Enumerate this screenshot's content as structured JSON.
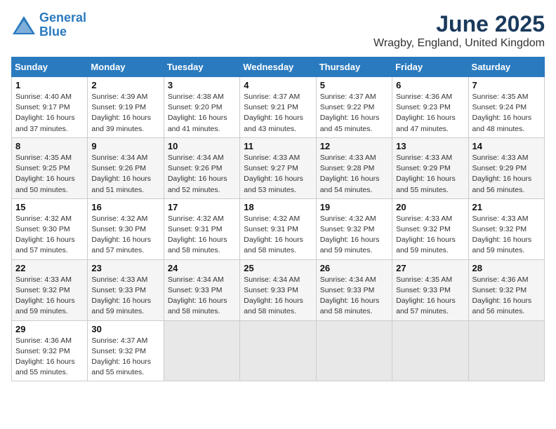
{
  "header": {
    "logo_line1": "General",
    "logo_line2": "Blue",
    "month_title": "June 2025",
    "location": "Wragby, England, United Kingdom"
  },
  "calendar": {
    "days_of_week": [
      "Sunday",
      "Monday",
      "Tuesday",
      "Wednesday",
      "Thursday",
      "Friday",
      "Saturday"
    ],
    "weeks": [
      [
        {
          "num": "",
          "info": ""
        },
        {
          "num": "2",
          "info": "Sunrise: 4:39 AM\nSunset: 9:19 PM\nDaylight: 16 hours\nand 39 minutes."
        },
        {
          "num": "3",
          "info": "Sunrise: 4:38 AM\nSunset: 9:20 PM\nDaylight: 16 hours\nand 41 minutes."
        },
        {
          "num": "4",
          "info": "Sunrise: 4:37 AM\nSunset: 9:21 PM\nDaylight: 16 hours\nand 43 minutes."
        },
        {
          "num": "5",
          "info": "Sunrise: 4:37 AM\nSunset: 9:22 PM\nDaylight: 16 hours\nand 45 minutes."
        },
        {
          "num": "6",
          "info": "Sunrise: 4:36 AM\nSunset: 9:23 PM\nDaylight: 16 hours\nand 47 minutes."
        },
        {
          "num": "7",
          "info": "Sunrise: 4:35 AM\nSunset: 9:24 PM\nDaylight: 16 hours\nand 48 minutes."
        }
      ],
      [
        {
          "num": "1",
          "info": "Sunrise: 4:40 AM\nSunset: 9:17 PM\nDaylight: 16 hours\nand 37 minutes."
        },
        {
          "num": "",
          "info": ""
        },
        {
          "num": "",
          "info": ""
        },
        {
          "num": "",
          "info": ""
        },
        {
          "num": "",
          "info": ""
        },
        {
          "num": "",
          "info": ""
        },
        {
          "num": "",
          "info": ""
        }
      ],
      [
        {
          "num": "8",
          "info": "Sunrise: 4:35 AM\nSunset: 9:25 PM\nDaylight: 16 hours\nand 50 minutes."
        },
        {
          "num": "9",
          "info": "Sunrise: 4:34 AM\nSunset: 9:26 PM\nDaylight: 16 hours\nand 51 minutes."
        },
        {
          "num": "10",
          "info": "Sunrise: 4:34 AM\nSunset: 9:26 PM\nDaylight: 16 hours\nand 52 minutes."
        },
        {
          "num": "11",
          "info": "Sunrise: 4:33 AM\nSunset: 9:27 PM\nDaylight: 16 hours\nand 53 minutes."
        },
        {
          "num": "12",
          "info": "Sunrise: 4:33 AM\nSunset: 9:28 PM\nDaylight: 16 hours\nand 54 minutes."
        },
        {
          "num": "13",
          "info": "Sunrise: 4:33 AM\nSunset: 9:29 PM\nDaylight: 16 hours\nand 55 minutes."
        },
        {
          "num": "14",
          "info": "Sunrise: 4:33 AM\nSunset: 9:29 PM\nDaylight: 16 hours\nand 56 minutes."
        }
      ],
      [
        {
          "num": "15",
          "info": "Sunrise: 4:32 AM\nSunset: 9:30 PM\nDaylight: 16 hours\nand 57 minutes."
        },
        {
          "num": "16",
          "info": "Sunrise: 4:32 AM\nSunset: 9:30 PM\nDaylight: 16 hours\nand 57 minutes."
        },
        {
          "num": "17",
          "info": "Sunrise: 4:32 AM\nSunset: 9:31 PM\nDaylight: 16 hours\nand 58 minutes."
        },
        {
          "num": "18",
          "info": "Sunrise: 4:32 AM\nSunset: 9:31 PM\nDaylight: 16 hours\nand 58 minutes."
        },
        {
          "num": "19",
          "info": "Sunrise: 4:32 AM\nSunset: 9:32 PM\nDaylight: 16 hours\nand 59 minutes."
        },
        {
          "num": "20",
          "info": "Sunrise: 4:33 AM\nSunset: 9:32 PM\nDaylight: 16 hours\nand 59 minutes."
        },
        {
          "num": "21",
          "info": "Sunrise: 4:33 AM\nSunset: 9:32 PM\nDaylight: 16 hours\nand 59 minutes."
        }
      ],
      [
        {
          "num": "22",
          "info": "Sunrise: 4:33 AM\nSunset: 9:32 PM\nDaylight: 16 hours\nand 59 minutes."
        },
        {
          "num": "23",
          "info": "Sunrise: 4:33 AM\nSunset: 9:33 PM\nDaylight: 16 hours\nand 59 minutes."
        },
        {
          "num": "24",
          "info": "Sunrise: 4:34 AM\nSunset: 9:33 PM\nDaylight: 16 hours\nand 58 minutes."
        },
        {
          "num": "25",
          "info": "Sunrise: 4:34 AM\nSunset: 9:33 PM\nDaylight: 16 hours\nand 58 minutes."
        },
        {
          "num": "26",
          "info": "Sunrise: 4:34 AM\nSunset: 9:33 PM\nDaylight: 16 hours\nand 58 minutes."
        },
        {
          "num": "27",
          "info": "Sunrise: 4:35 AM\nSunset: 9:33 PM\nDaylight: 16 hours\nand 57 minutes."
        },
        {
          "num": "28",
          "info": "Sunrise: 4:36 AM\nSunset: 9:32 PM\nDaylight: 16 hours\nand 56 minutes."
        }
      ],
      [
        {
          "num": "29",
          "info": "Sunrise: 4:36 AM\nSunset: 9:32 PM\nDaylight: 16 hours\nand 55 minutes."
        },
        {
          "num": "30",
          "info": "Sunrise: 4:37 AM\nSunset: 9:32 PM\nDaylight: 16 hours\nand 55 minutes."
        },
        {
          "num": "",
          "info": ""
        },
        {
          "num": "",
          "info": ""
        },
        {
          "num": "",
          "info": ""
        },
        {
          "num": "",
          "info": ""
        },
        {
          "num": "",
          "info": ""
        }
      ]
    ]
  }
}
